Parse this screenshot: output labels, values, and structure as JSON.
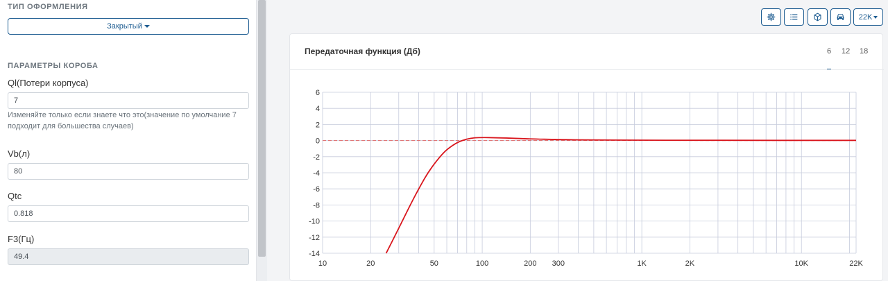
{
  "left": {
    "design_type_title": "ТИП ОФОРМЛЕНИЯ",
    "design_type_value": "Закрытый",
    "box_params_title": "ПАРАМЕТРЫ КОРОБА",
    "fields": {
      "ql_label": "Ql(Потери корпуса)",
      "ql_value": "7",
      "ql_hint": "Изменяйте только если знаете что это(значение по умолчание 7 подходит для большества случаев)",
      "vb_label": "Vb(л)",
      "vb_value": "80",
      "qtc_label": "Qtc",
      "qtc_value": "0.818",
      "f3_label": "F3(Гц)",
      "f3_value": "49.4"
    }
  },
  "toolbar": {
    "icons": [
      "gear-icon",
      "list-icon",
      "cube-icon",
      "car-icon"
    ],
    "range_label": "22K"
  },
  "card": {
    "title": "Передаточная функция (Дб)",
    "slope_tabs": [
      "6",
      "12",
      "18"
    ],
    "active_slope": "6"
  },
  "colors": {
    "accent": "#1d5c91",
    "curve": "#d9161d",
    "reference_line": "#e06666",
    "grid": "#c6cbdc"
  },
  "chart_data": {
    "type": "line",
    "x_scale": "log",
    "xlim": [
      10,
      22000
    ],
    "ylim": [
      -14,
      6
    ],
    "y_ticks": [
      6,
      4,
      2,
      0,
      -2,
      -4,
      -6,
      -8,
      -10,
      -12,
      -14
    ],
    "x_ticks": [
      {
        "value": 10,
        "label": "10"
      },
      {
        "value": 20,
        "label": "20"
      },
      {
        "value": 50,
        "label": "50"
      },
      {
        "value": 100,
        "label": "100"
      },
      {
        "value": 200,
        "label": "200"
      },
      {
        "value": 300,
        "label": "300"
      },
      {
        "value": 1000,
        "label": "1K"
      },
      {
        "value": 2000,
        "label": "2K"
      },
      {
        "value": 10000,
        "label": "10K"
      },
      {
        "value": 22000,
        "label": "22K"
      }
    ],
    "reference_line_y": 0,
    "series": [
      {
        "x": [
          25,
          30,
          35,
          40,
          45,
          50,
          55,
          60,
          70,
          80,
          90,
          100,
          120,
          150,
          200,
          300,
          500,
          1000,
          2000,
          5000,
          10000,
          22000
        ],
        "y": [
          -14,
          -10.9,
          -8.2,
          -6.0,
          -4.2,
          -2.9,
          -1.9,
          -1.1,
          -0.2,
          0.2,
          0.35,
          0.38,
          0.36,
          0.3,
          0.2,
          0.12,
          0.07,
          0.05,
          0.04,
          0.03,
          0.03,
          0.03
        ]
      }
    ]
  }
}
